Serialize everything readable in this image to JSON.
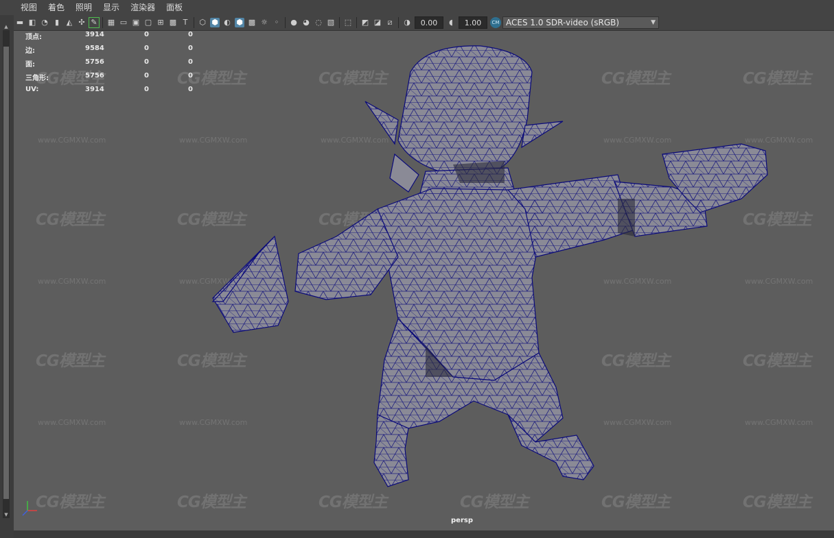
{
  "menu": [
    "视图",
    "着色",
    "照明",
    "显示",
    "渲染器",
    "面板"
  ],
  "toolbar": {
    "exposure": "0.00",
    "gamma": "1.00",
    "color_space": "ACES 1.0 SDR-video (sRGB)"
  },
  "hud": {
    "rows": [
      {
        "label": "顶点:",
        "v1": "3914",
        "v2": "0",
        "v3": "0"
      },
      {
        "label": "边:",
        "v1": "9584",
        "v2": "0",
        "v3": "0"
      },
      {
        "label": "面:",
        "v1": "5756",
        "v2": "0",
        "v3": "0"
      },
      {
        "label": "三角形:",
        "v1": "5756",
        "v2": "0",
        "v3": "0"
      },
      {
        "label": "UV:",
        "v1": "3914",
        "v2": "0",
        "v3": "0"
      }
    ]
  },
  "camera_label": "persp",
  "watermark": {
    "logo": "CG模型主",
    "url": "www.CGMXW.com"
  },
  "colors": {
    "wireframe": "#0a0a7a",
    "mesh_fill": "#8a8a96",
    "viewport_bg": "#5d5d5d"
  }
}
